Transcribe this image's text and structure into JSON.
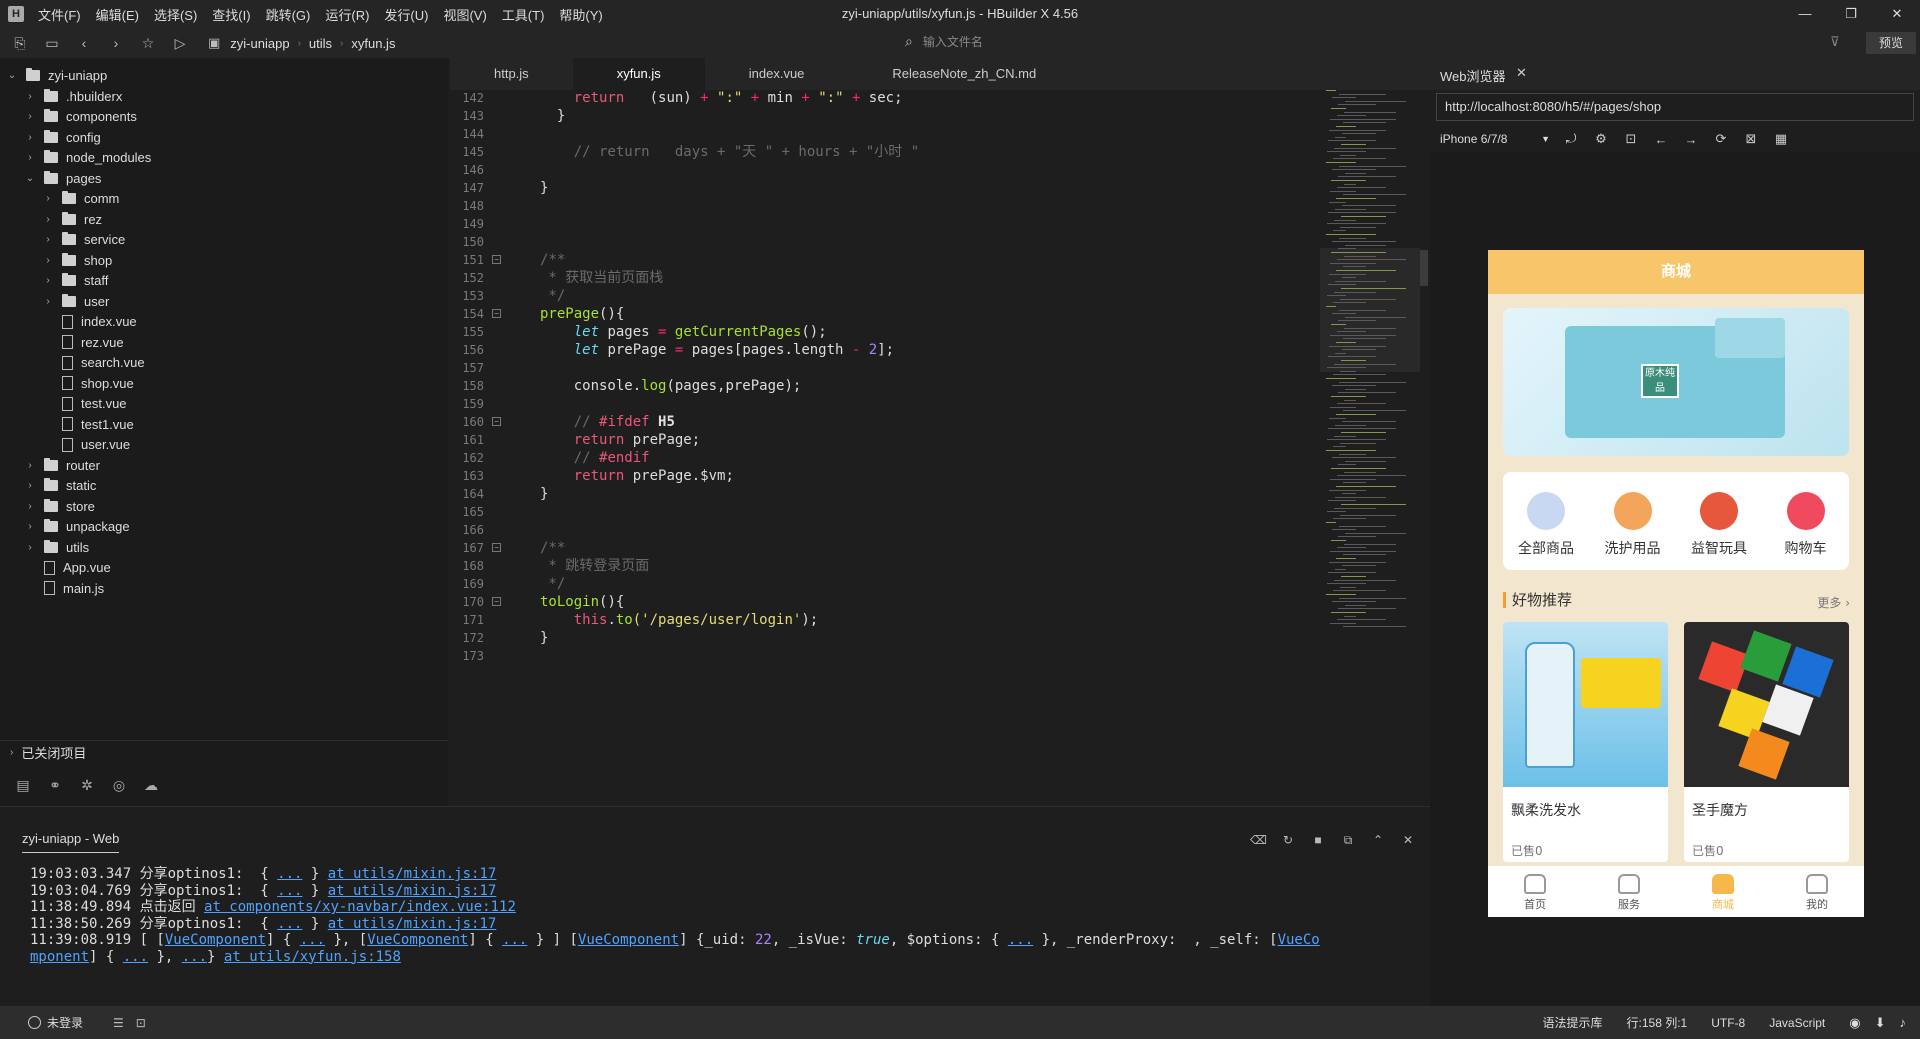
{
  "app": {
    "title": "zyi-uniapp/utils/xyfun.js - HBuilder X 4.56",
    "logo": "H"
  },
  "menu": [
    "文件(F)",
    "编辑(E)",
    "选择(S)",
    "查找(I)",
    "跳转(G)",
    "运行(R)",
    "发行(U)",
    "视图(V)",
    "工具(T)",
    "帮助(Y)"
  ],
  "window_controls": {
    "minimize": "—",
    "restore": "❐",
    "close": "✕"
  },
  "toolbar": {
    "breadcrumb": [
      "zyi-uniapp",
      "utils",
      "xyfun.js"
    ],
    "file_search_placeholder": "输入文件名",
    "preview_label": "预览"
  },
  "sidebar": {
    "tree": [
      {
        "label": "zyi-uniapp",
        "type": "folder",
        "depth": 0,
        "expanded": true
      },
      {
        "label": ".hbuilderx",
        "type": "folder",
        "depth": 1,
        "expanded": false
      },
      {
        "label": "components",
        "type": "folder",
        "depth": 1,
        "expanded": false
      },
      {
        "label": "config",
        "type": "folder",
        "depth": 1,
        "expanded": false
      },
      {
        "label": "node_modules",
        "type": "folder",
        "depth": 1,
        "expanded": false
      },
      {
        "label": "pages",
        "type": "folder",
        "depth": 1,
        "expanded": true
      },
      {
        "label": "comm",
        "type": "folder",
        "depth": 2,
        "expanded": false
      },
      {
        "label": "rez",
        "type": "folder",
        "depth": 2,
        "expanded": false
      },
      {
        "label": "service",
        "type": "folder",
        "depth": 2,
        "expanded": false
      },
      {
        "label": "shop",
        "type": "folder",
        "depth": 2,
        "expanded": false
      },
      {
        "label": "staff",
        "type": "folder",
        "depth": 2,
        "expanded": false
      },
      {
        "label": "user",
        "type": "folder",
        "depth": 2,
        "expanded": false
      },
      {
        "label": "index.vue",
        "type": "file",
        "depth": 2
      },
      {
        "label": "rez.vue",
        "type": "file",
        "depth": 2
      },
      {
        "label": "search.vue",
        "type": "file",
        "depth": 2
      },
      {
        "label": "shop.vue",
        "type": "file",
        "depth": 2
      },
      {
        "label": "test.vue",
        "type": "file",
        "depth": 2
      },
      {
        "label": "test1.vue",
        "type": "file",
        "depth": 2
      },
      {
        "label": "user.vue",
        "type": "file",
        "depth": 2
      },
      {
        "label": "router",
        "type": "folder",
        "depth": 1,
        "expanded": false
      },
      {
        "label": "static",
        "type": "folder",
        "depth": 1,
        "expanded": false
      },
      {
        "label": "store",
        "type": "folder",
        "depth": 1,
        "expanded": false
      },
      {
        "label": "unpackage",
        "type": "folder",
        "depth": 1,
        "expanded": false
      },
      {
        "label": "utils",
        "type": "folder",
        "depth": 1,
        "expanded": false
      },
      {
        "label": "App.vue",
        "type": "file",
        "depth": 1
      },
      {
        "label": "main.js",
        "type": "file",
        "depth": 1
      }
    ],
    "closed_projects_label": "已关闭项目"
  },
  "editor": {
    "tabs": [
      {
        "label": "http.js",
        "active": false
      },
      {
        "label": "xyfun.js",
        "active": true
      },
      {
        "label": "index.vue",
        "active": false
      },
      {
        "label": "ReleaseNote_zh_CN.md",
        "active": false
      }
    ],
    "line_numbers": [
      "142",
      "143",
      "144",
      "145",
      "146",
      "147",
      "148",
      "149",
      "150",
      "151",
      "152",
      "153",
      "154",
      "155",
      "156",
      "157",
      "158",
      "159",
      "160",
      "161",
      "162",
      "163",
      "164",
      "165",
      "166",
      "167",
      "168",
      "169",
      "170",
      "171",
      "172",
      "173"
    ],
    "fold_lines": [
      "151",
      "154",
      "160",
      "167",
      "170"
    ],
    "code": [
      [
        [
          "    ",
          ""
        ],
        [
          "return",
          "kw"
        ],
        [
          "   (sun) ",
          ""
        ],
        [
          "+",
          "op"
        ],
        [
          " \":\" ",
          "str"
        ],
        [
          "+",
          "op"
        ],
        [
          " min ",
          ""
        ],
        [
          "+",
          "op"
        ],
        [
          " \":\" ",
          "str"
        ],
        [
          "+",
          "op"
        ],
        [
          " sec;",
          ""
        ]
      ],
      [
        [
          "  }",
          ""
        ]
      ],
      [
        [
          "",
          ""
        ]
      ],
      [
        [
          "    // return   days + \"天 \" + hours + \"小时 \"",
          "cm"
        ]
      ],
      [
        [
          "",
          ""
        ]
      ],
      [
        [
          "}",
          ""
        ]
      ],
      [
        [
          "",
          ""
        ]
      ],
      [
        [
          "",
          ""
        ]
      ],
      [
        [
          "",
          ""
        ]
      ],
      [
        [
          "/**",
          "cm"
        ]
      ],
      [
        [
          " * 获取当前页面栈",
          "cm"
        ]
      ],
      [
        [
          " */",
          "cm"
        ]
      ],
      [
        [
          "prePage",
          "fn"
        ],
        [
          "(){",
          ""
        ]
      ],
      [
        [
          "    ",
          ""
        ],
        [
          "let",
          "kwi"
        ],
        [
          " pages ",
          ""
        ],
        [
          "=",
          "op"
        ],
        [
          " ",
          ""
        ],
        [
          "getCurrentPages",
          "fn"
        ],
        [
          "();",
          ""
        ]
      ],
      [
        [
          "    ",
          ""
        ],
        [
          "let",
          "kwi"
        ],
        [
          " prePage ",
          ""
        ],
        [
          "=",
          "op"
        ],
        [
          " pages[pages.length ",
          ""
        ],
        [
          "-",
          "op"
        ],
        [
          " ",
          ""
        ],
        [
          "2",
          "num"
        ],
        [
          "];",
          ""
        ]
      ],
      [
        [
          "",
          ""
        ]
      ],
      [
        [
          "    console.",
          ""
        ],
        [
          "log",
          "fn"
        ],
        [
          "(pages,prePage);",
          ""
        ]
      ],
      [
        [
          "",
          ""
        ]
      ],
      [
        [
          "    // ",
          "cm"
        ],
        [
          "#ifdef",
          "kw"
        ],
        [
          " H5",
          "mac"
        ]
      ],
      [
        [
          "    ",
          ""
        ],
        [
          "return",
          "kw"
        ],
        [
          " prePage;",
          ""
        ]
      ],
      [
        [
          "    // ",
          "cm"
        ],
        [
          "#endif",
          "kw"
        ]
      ],
      [
        [
          "    ",
          ""
        ],
        [
          "return",
          "kw"
        ],
        [
          " prePage.$vm;",
          ""
        ]
      ],
      [
        [
          "}",
          ""
        ]
      ],
      [
        [
          "",
          ""
        ]
      ],
      [
        [
          "",
          ""
        ]
      ],
      [
        [
          "/**",
          "cm"
        ]
      ],
      [
        [
          " * 跳转登录页面",
          "cm"
        ]
      ],
      [
        [
          " */",
          "cm"
        ]
      ],
      [
        [
          "toLogin",
          "fn"
        ],
        [
          "(){",
          ""
        ]
      ],
      [
        [
          "    ",
          ""
        ],
        [
          "this",
          "kw"
        ],
        [
          ".",
          ""
        ],
        [
          "to",
          "fn"
        ],
        [
          "('/pages/user/login'",
          "str"
        ],
        [
          ");",
          ""
        ]
      ],
      [
        [
          "}",
          ""
        ]
      ],
      [
        [
          "",
          ""
        ]
      ]
    ]
  },
  "console": {
    "title": "zyi-uniapp - Web",
    "lines": [
      [
        [
          "19:03:03.347 分享optinos1:  { ",
          ""
        ],
        [
          "...",
          "lk"
        ],
        [
          " } ",
          ""
        ],
        [
          "at utils/mixin.js:17",
          "lk"
        ]
      ],
      [
        [
          "19:03:04.769 分享optinos1:  { ",
          ""
        ],
        [
          "...",
          "lk"
        ],
        [
          " } ",
          ""
        ],
        [
          "at utils/mixin.js:17",
          "lk"
        ]
      ],
      [
        [
          "11:38:49.894 点击返回 ",
          ""
        ],
        [
          "at components/xy-navbar/index.vue:112",
          "lk"
        ]
      ],
      [
        [
          "11:38:50.269 分享optinos1:  { ",
          ""
        ],
        [
          "...",
          "lk"
        ],
        [
          " } ",
          ""
        ],
        [
          "at utils/mixin.js:17",
          "lk"
        ]
      ],
      [
        [
          "11:39:08.919 [ [",
          ""
        ],
        [
          "VueComponent",
          "lk"
        ],
        [
          "] { ",
          ""
        ],
        [
          "...",
          "lk"
        ],
        [
          " }, [",
          ""
        ],
        [
          "VueComponent",
          "lk"
        ],
        [
          "] { ",
          ""
        ],
        [
          "...",
          "lk"
        ],
        [
          " } ] [",
          ""
        ],
        [
          "VueComponent",
          "lk"
        ],
        [
          "] {_uid: ",
          ""
        ],
        [
          "22",
          "num"
        ],
        [
          ", _isVue: ",
          ""
        ],
        [
          "true",
          "kwi"
        ],
        [
          ", $options: { ",
          ""
        ],
        [
          "...",
          "lk"
        ],
        [
          " }, _renderProxy:  , _self: [",
          ""
        ],
        [
          "VueCo",
          "lk"
        ]
      ],
      [
        [
          "mponent",
          "lk"
        ],
        [
          "] { ",
          ""
        ],
        [
          "...",
          "lk"
        ],
        [
          " }, ",
          ""
        ],
        [
          "...",
          "lk"
        ],
        [
          "} ",
          ""
        ],
        [
          "at utils/xyfun.js:158",
          "lk"
        ]
      ]
    ]
  },
  "browser": {
    "tab_label": "Web浏览器",
    "url": "http://localhost:8080/h5/#/pages/shop",
    "device": "iPhone 6/7/8"
  },
  "phone": {
    "header_title": "商城",
    "banner_label": "原木纯品",
    "categories": [
      {
        "label": "全部商品",
        "color": "#c9d8f2"
      },
      {
        "label": "洗护用品",
        "color": "#f4a55c"
      },
      {
        "label": "益智玩具",
        "color": "#e6573b"
      },
      {
        "label": "购物车",
        "color": "#f04a5e"
      }
    ],
    "rec_title": "好物推荐",
    "more_label": "更多 ›",
    "products": [
      {
        "name": "飘柔洗发水",
        "sold": "已售0"
      },
      {
        "name": "圣手魔方",
        "sold": "已售0"
      }
    ],
    "tabbar": [
      {
        "label": "首页",
        "active": false
      },
      {
        "label": "服务",
        "active": false
      },
      {
        "label": "商城",
        "active": true
      },
      {
        "label": "我的",
        "active": false
      }
    ]
  },
  "statusbar": {
    "login": "未登录",
    "syntax_hint": "语法提示库",
    "position": "行:158  列:1",
    "encoding": "UTF-8",
    "language": "JavaScript"
  }
}
